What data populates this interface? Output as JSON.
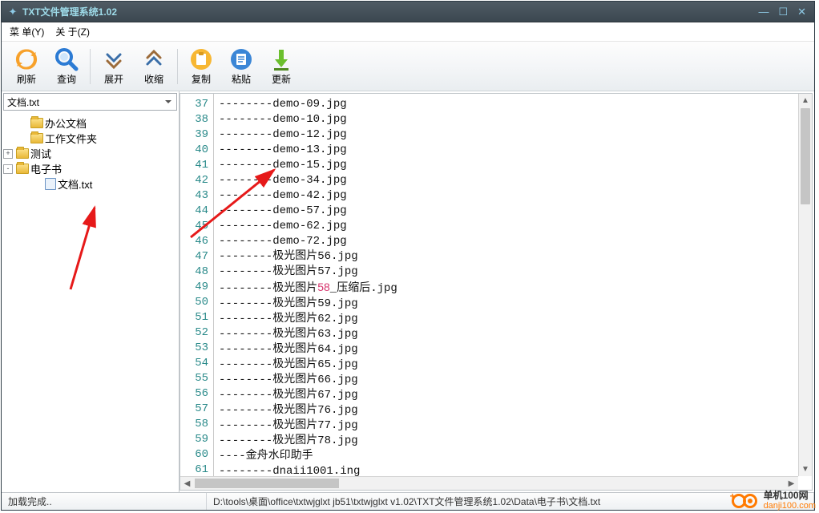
{
  "window": {
    "title": "TXT文件管理系统1.02"
  },
  "menu": {
    "items": [
      "菜 单(Y)",
      "关 于(Z)"
    ]
  },
  "toolbar": {
    "buttons": [
      {
        "id": "refresh",
        "label": "刷新"
      },
      {
        "id": "query",
        "label": "查询"
      },
      {
        "id": "expand",
        "label": "展开"
      },
      {
        "id": "collapse",
        "label": "收缩"
      },
      {
        "id": "copy",
        "label": "复制"
      },
      {
        "id": "paste",
        "label": "粘贴"
      },
      {
        "id": "update",
        "label": "更新"
      }
    ]
  },
  "combo": {
    "value": "文档.txt"
  },
  "tree": {
    "items": [
      {
        "expander": "",
        "icon": "folder",
        "label": "办公文档",
        "indent": 1
      },
      {
        "expander": "",
        "icon": "folder",
        "label": "工作文件夹",
        "indent": 1
      },
      {
        "expander": "+",
        "icon": "folder",
        "label": "测试",
        "indent": 0
      },
      {
        "expander": "-",
        "icon": "folder",
        "label": "电子书",
        "indent": 0
      },
      {
        "expander": "",
        "icon": "file",
        "label": "文档.txt",
        "indent": 2
      }
    ]
  },
  "code": {
    "first_line_no": 37,
    "lines": [
      "--------demo-09.jpg",
      "--------demo-10.jpg",
      "--------demo-12.jpg",
      "--------demo-13.jpg",
      "--------demo-15.jpg",
      "--------demo-34.jpg",
      "--------demo-42.jpg",
      "--------demo-57.jpg",
      "--------demo-62.jpg",
      "--------demo-72.jpg",
      "--------极光图片56.jpg",
      "--------极光图片57.jpg",
      {
        "prefix": "--------极光图片",
        "hl": "58",
        "suffix": "_压缩后.jpg"
      },
      "--------极光图片59.jpg",
      "--------极光图片62.jpg",
      "--------极光图片63.jpg",
      "--------极光图片64.jpg",
      "--------极光图片65.jpg",
      "--------极光图片66.jpg",
      "--------极光图片67.jpg",
      "--------极光图片76.jpg",
      "--------极光图片77.jpg",
      "--------极光图片78.jpg",
      "----金舟水印助手",
      "--------dnaii1001.ing"
    ]
  },
  "status": {
    "left": "加载完成..",
    "path": "D:\\tools\\桌面\\office\\txtwjglxt jb51\\txtwjglxt v1.02\\TXT文件管理系统1.02\\Data\\电子书\\文档.txt"
  },
  "watermark": {
    "line1": "单机100网",
    "line2": "danji100.com"
  }
}
